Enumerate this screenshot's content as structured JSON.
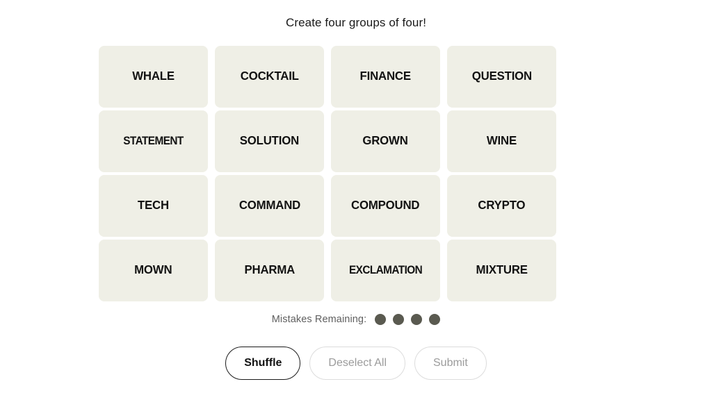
{
  "page": {
    "background_color": "#ffffff",
    "title": "Create four groups of four!"
  },
  "board": {
    "tile_bg_color": "#efefe6",
    "tile_text_color": "#121212",
    "rows": [
      [
        "WHALE",
        "COCKTAIL",
        "FINANCE",
        "QUESTION"
      ],
      [
        "STATEMENT",
        "SOLUTION",
        "GROWN",
        "WINE"
      ],
      [
        "TECH",
        "COMMAND",
        "COMPOUND",
        "CRYPTO"
      ],
      [
        "MOWN",
        "PHARMA",
        "EXCLAMATION",
        "MIXTURE"
      ]
    ],
    "tiles": [
      {
        "label": "WHALE",
        "selected": false
      },
      {
        "label": "COCKTAIL",
        "selected": false
      },
      {
        "label": "FINANCE",
        "selected": false
      },
      {
        "label": "QUESTION",
        "selected": false
      },
      {
        "label": "STATEMENT",
        "selected": false
      },
      {
        "label": "SOLUTION",
        "selected": false
      },
      {
        "label": "GROWN",
        "selected": false
      },
      {
        "label": "WINE",
        "selected": false
      },
      {
        "label": "TECH",
        "selected": false
      },
      {
        "label": "COMMAND",
        "selected": false
      },
      {
        "label": "COMPOUND",
        "selected": false
      },
      {
        "label": "CRYPTO",
        "selected": false
      },
      {
        "label": "MOWN",
        "selected": false
      },
      {
        "label": "PHARMA",
        "selected": false
      },
      {
        "label": "EXCLAMATION",
        "selected": false
      },
      {
        "label": "MIXTURE",
        "selected": false
      }
    ]
  },
  "mistakes": {
    "label": "Mistakes Remaining:",
    "remaining": 4,
    "dot_color": "#5a5a50"
  },
  "actions": {
    "shuffle": {
      "label": "Shuffle",
      "enabled": true
    },
    "deselect_all": {
      "label": "Deselect All",
      "enabled": false
    },
    "submit": {
      "label": "Submit",
      "enabled": false
    }
  }
}
